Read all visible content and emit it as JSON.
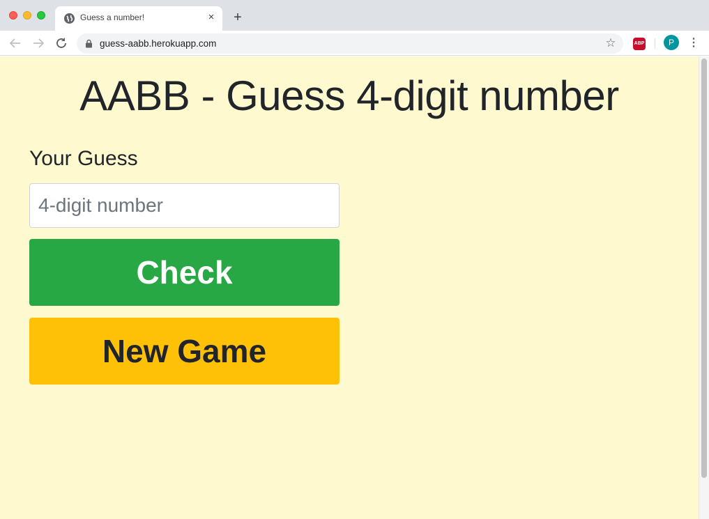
{
  "browser": {
    "tab_title": "Guess a number!",
    "tab_close": "×",
    "new_tab": "+",
    "url": "guess-aabb.herokuapp.com",
    "abp_label": "ABP",
    "profile_initial": "P",
    "icons": {
      "back": "arrow-left-icon",
      "forward": "arrow-right-icon",
      "reload": "reload-icon",
      "lock": "lock-icon",
      "bookmark": "star-icon",
      "menu": "kebab-menu-icon"
    }
  },
  "page": {
    "title": "AABB - Guess 4-digit number",
    "guess_label": "Your Guess",
    "guess_input": {
      "value": "",
      "placeholder": "4-digit number"
    },
    "check_button": "Check",
    "new_game_button": "New Game"
  },
  "colors": {
    "background": "#fff9cf",
    "check": "#28a745",
    "new_game": "#ffc107",
    "profile": "#00959f"
  }
}
